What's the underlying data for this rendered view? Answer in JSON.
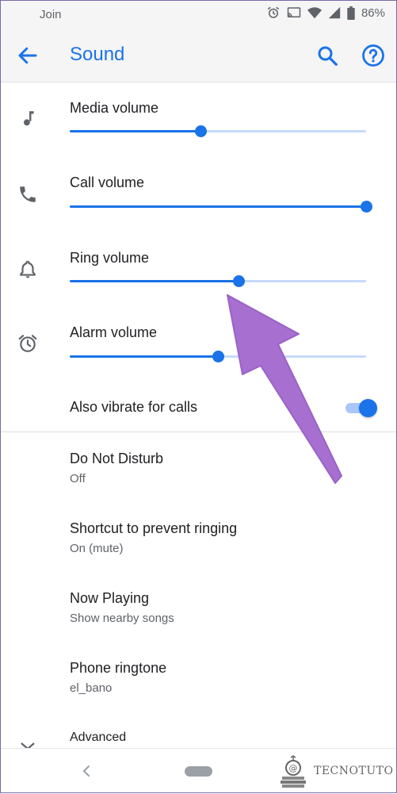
{
  "status_bar": {
    "notification": "Join",
    "battery": "86%"
  },
  "app_bar": {
    "title": "Sound"
  },
  "volumes": [
    {
      "label": "Media volume",
      "level": 0.44,
      "icon": "music-note-icon"
    },
    {
      "label": "Call volume",
      "level": 1.0,
      "icon": "phone-icon"
    },
    {
      "label": "Ring volume",
      "level": 0.57,
      "icon": "bell-icon"
    },
    {
      "label": "Alarm volume",
      "level": 0.5,
      "icon": "alarm-clock-icon"
    }
  ],
  "vibrate": {
    "label": "Also vibrate for calls",
    "enabled": true
  },
  "items": [
    {
      "title": "Do Not Disturb",
      "subtitle": "Off"
    },
    {
      "title": "Shortcut to prevent ringing",
      "subtitle": "On (mute)"
    },
    {
      "title": "Now Playing",
      "subtitle": "Show nearby songs"
    },
    {
      "title": "Phone ringtone",
      "subtitle": "el_bano"
    }
  ],
  "advanced": {
    "label": "Advanced"
  },
  "watermark": {
    "text": "TECNOTUTO"
  },
  "colors": {
    "accent": "#1a73e8",
    "track": "#c6dafc",
    "arrow": "#a66fd0"
  }
}
